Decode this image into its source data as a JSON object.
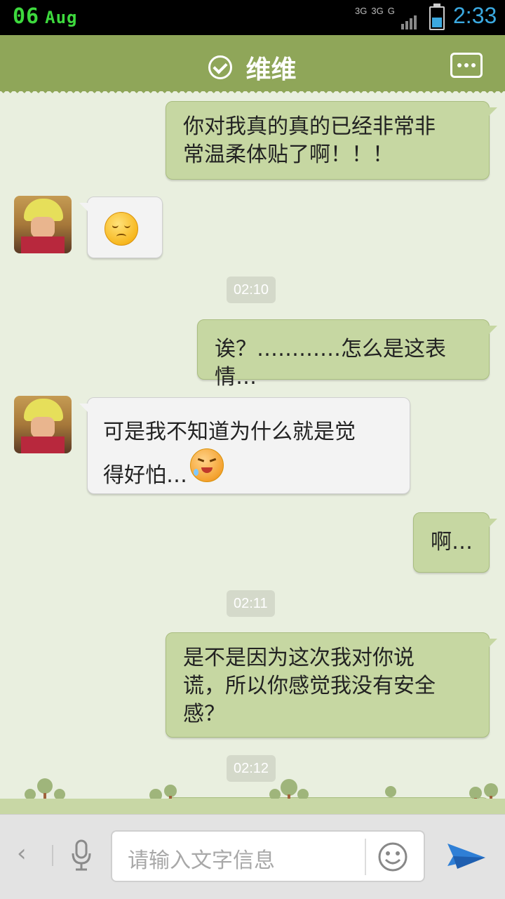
{
  "status_bar": {
    "day": "06",
    "month": "Aug",
    "network_1": "3G",
    "network_2": "3G",
    "network_3": "G",
    "time": "2:33",
    "battery_level_percent": 55
  },
  "header": {
    "title": "维维",
    "status_icon": "check-circle-icon",
    "more_icon": "chat-more-icon"
  },
  "messages": [
    {
      "side": "out",
      "text": "你对我真的真的已经非常非\n常温柔体贴了啊！！！"
    },
    {
      "side": "in",
      "emoji": "sad-emoji"
    },
    {
      "timestamp": "02:10"
    },
    {
      "side": "out",
      "text": "诶？…………怎么是这表情…"
    },
    {
      "side": "in",
      "text": "可是我不知道为什么就是觉\n得好怕…",
      "emoji": "crying-emoji"
    },
    {
      "side": "out",
      "text": "啊…"
    },
    {
      "timestamp": "02:11"
    },
    {
      "side": "out",
      "text": "是不是因为这次我对你说\n谎，所以你感觉我没有安全\n感？"
    },
    {
      "timestamp": "02:12"
    }
  ],
  "input_bar": {
    "placeholder": "请输入文字信息",
    "back_icon": "chevron-left-icon",
    "mic_icon": "microphone-icon",
    "emoji_icon": "smiley-icon",
    "send_icon": "send-icon"
  },
  "colors": {
    "header": "#8fa659",
    "outgoing_bubble": "#c6d7a2",
    "incoming_bubble": "#f3f3f3",
    "background": "#e9efdf",
    "time_accent": "#3ba9e0"
  }
}
